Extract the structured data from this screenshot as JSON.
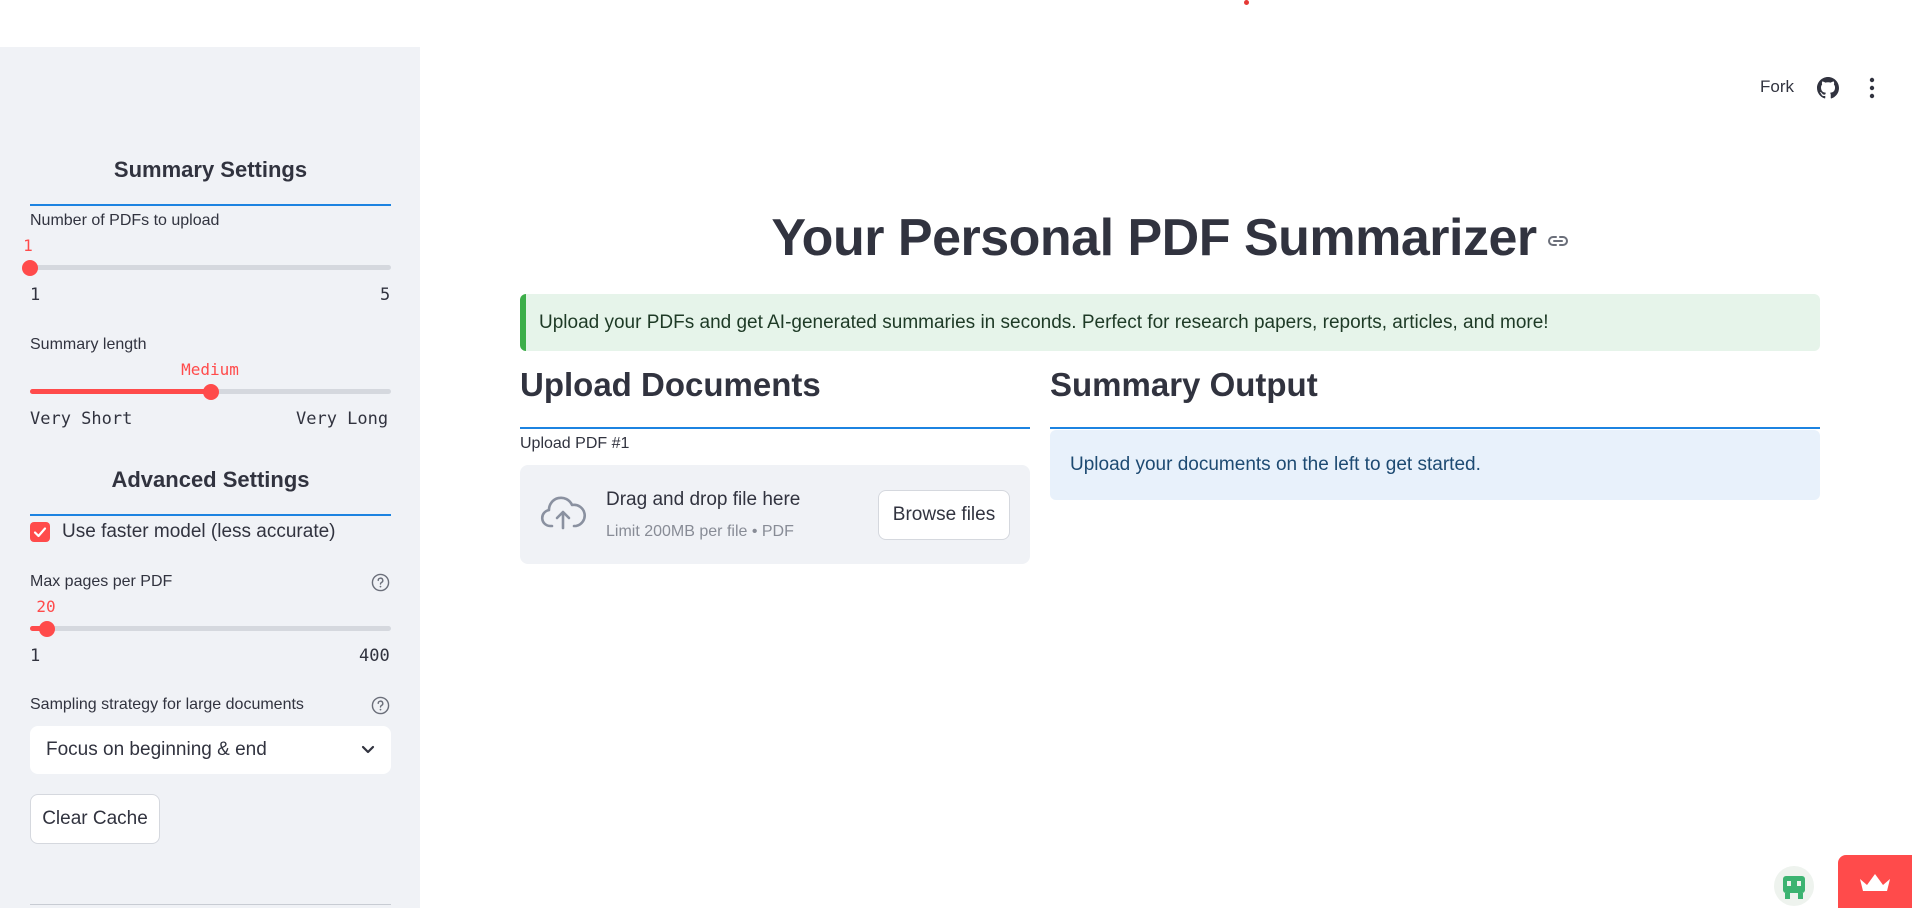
{
  "sidebar": {
    "summary_settings_heading": "Summary Settings",
    "num_pdfs": {
      "label": "Number of PDFs to upload",
      "value": "1",
      "min": "1",
      "max": "5",
      "fraction": 0.0
    },
    "summary_length": {
      "label": "Summary length",
      "value": "Medium",
      "min": "Very Short",
      "max": "Very Long",
      "fraction": 0.5
    },
    "advanced_settings_heading": "Advanced Settings",
    "faster_model": {
      "label": "Use faster model (less accurate)",
      "checked": true
    },
    "max_pages": {
      "label": "Max pages per PDF",
      "value": "20",
      "min": "1",
      "max": "400",
      "fraction": 0.048
    },
    "sampling": {
      "label": "Sampling strategy for large documents",
      "value": "Focus on beginning & end"
    },
    "clear_cache_label": "Clear Cache"
  },
  "header": {
    "fork_label": "Fork"
  },
  "main": {
    "title": "Your Personal PDF Summarizer",
    "success_message": "Upload your PDFs and get AI-generated summaries in seconds. Perfect for research papers, reports, articles, and more!",
    "upload_section_title": "Upload Documents",
    "upload_label": "Upload PDF #1",
    "dropzone_title": "Drag and drop file here",
    "dropzone_limit": "Limit 200MB per file • PDF",
    "browse_label": "Browse files",
    "summary_section_title": "Summary Output",
    "summary_info": "Upload your documents on the left to get started."
  },
  "colors": {
    "accent": "#ff4b4b",
    "rule": "#1c83e1",
    "sidebar_bg": "#f0f2f6",
    "success_bg": "#e6f4ea",
    "info_bg": "#e8f1fb"
  }
}
